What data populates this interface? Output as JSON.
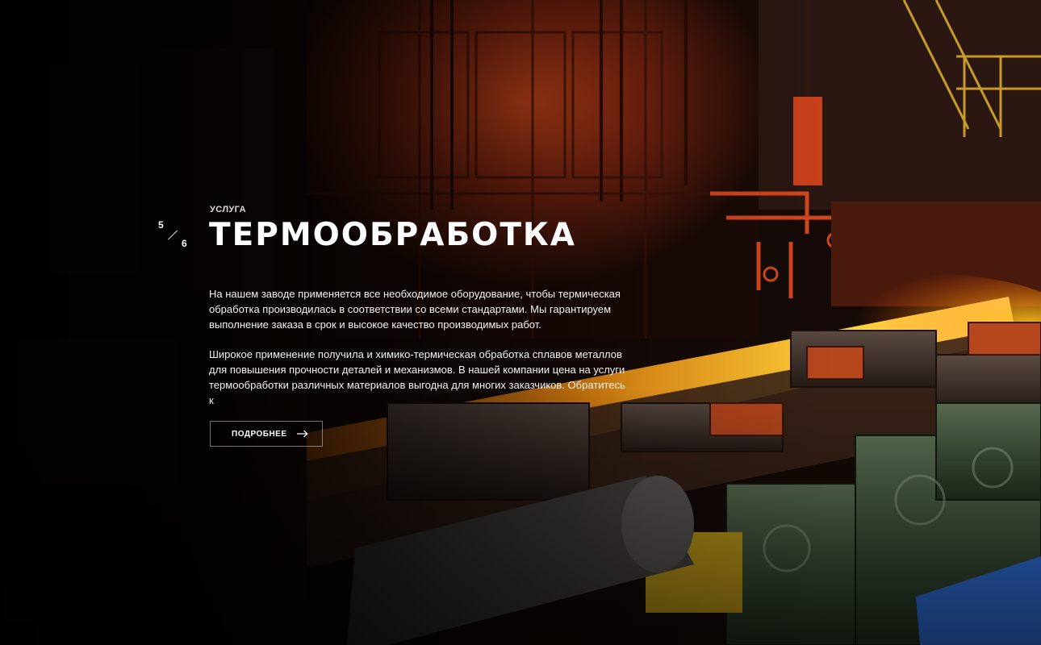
{
  "slider": {
    "current": "5",
    "total": "6"
  },
  "hero": {
    "eyebrow": "УСЛУГА",
    "title": "ТЕРМООБРАБОТКА",
    "paragraph_1": "На нашем заводе применяется все необходимое оборудование, чтобы термическая обработка производилась в соответствии со всеми стандартами. Мы гарантируем выполнение заказа в срок и высокое качество производимых работ.",
    "paragraph_2": "Широкое применение получила и химико-термическая обработка сплавов металлов для повышения прочности деталей и механизмов. В нашей компании цена на услуги термообработки различных материалов выгодна для многих заказчиков. Обратитесь к",
    "button_label": "ПОДРОБНЕЕ",
    "button_icon": "arrow-right-icon"
  },
  "colors": {
    "glow": "#ffb400",
    "hot_orange": "#e0521a",
    "machine_green": "#3e5a3a",
    "machine_blue": "#2f6fd8"
  }
}
